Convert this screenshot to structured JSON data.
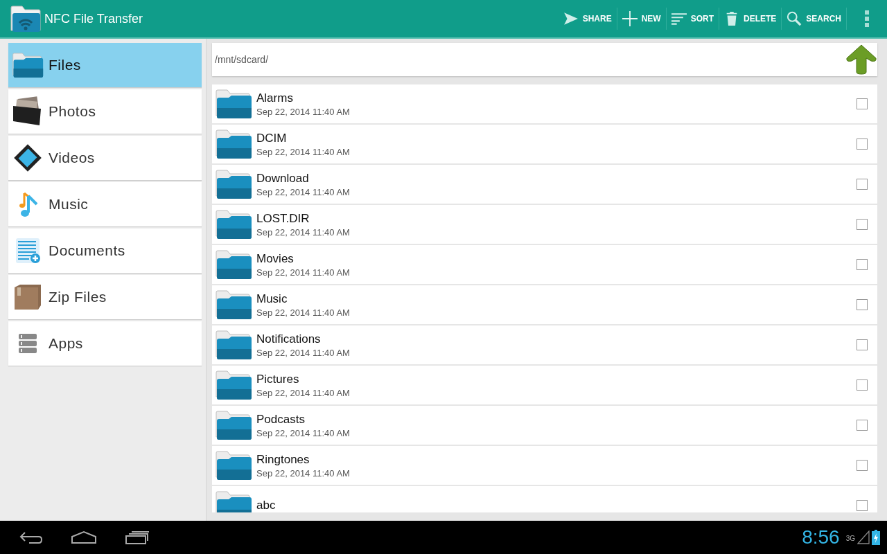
{
  "app_bar": {
    "title": "NFC File Transfer",
    "actions": [
      {
        "label": "SHARE"
      },
      {
        "label": "NEW"
      },
      {
        "label": "SORT"
      },
      {
        "label": "DELETE"
      },
      {
        "label": "SEARCH"
      }
    ]
  },
  "sidebar": {
    "items": [
      {
        "label": "Files",
        "selected": true
      },
      {
        "label": "Photos",
        "selected": false
      },
      {
        "label": "Videos",
        "selected": false
      },
      {
        "label": "Music",
        "selected": false
      },
      {
        "label": "Documents",
        "selected": false
      },
      {
        "label": "Zip Files",
        "selected": false
      },
      {
        "label": "Apps",
        "selected": false
      }
    ]
  },
  "path_bar": {
    "path": "/mnt/sdcard/"
  },
  "files": [
    {
      "name": "Alarms",
      "date": "Sep 22, 2014 11:40 AM",
      "checked": false
    },
    {
      "name": "DCIM",
      "date": "Sep 22, 2014 11:40 AM",
      "checked": false
    },
    {
      "name": "Download",
      "date": "Sep 22, 2014 11:40 AM",
      "checked": false
    },
    {
      "name": "LOST.DIR",
      "date": "Sep 22, 2014 11:40 AM",
      "checked": false
    },
    {
      "name": "Movies",
      "date": "Sep 22, 2014 11:40 AM",
      "checked": false
    },
    {
      "name": "Music",
      "date": "Sep 22, 2014 11:40 AM",
      "checked": false
    },
    {
      "name": "Notifications",
      "date": "Sep 22, 2014 11:40 AM",
      "checked": false
    },
    {
      "name": "Pictures",
      "date": "Sep 22, 2014 11:40 AM",
      "checked": false
    },
    {
      "name": "Podcasts",
      "date": "Sep 22, 2014 11:40 AM",
      "checked": false
    },
    {
      "name": "Ringtones",
      "date": "Sep 22, 2014 11:40 AM",
      "checked": false
    },
    {
      "name": "abc",
      "checked": false
    }
  ],
  "system_bar": {
    "time": "8:56",
    "network": "3G"
  }
}
